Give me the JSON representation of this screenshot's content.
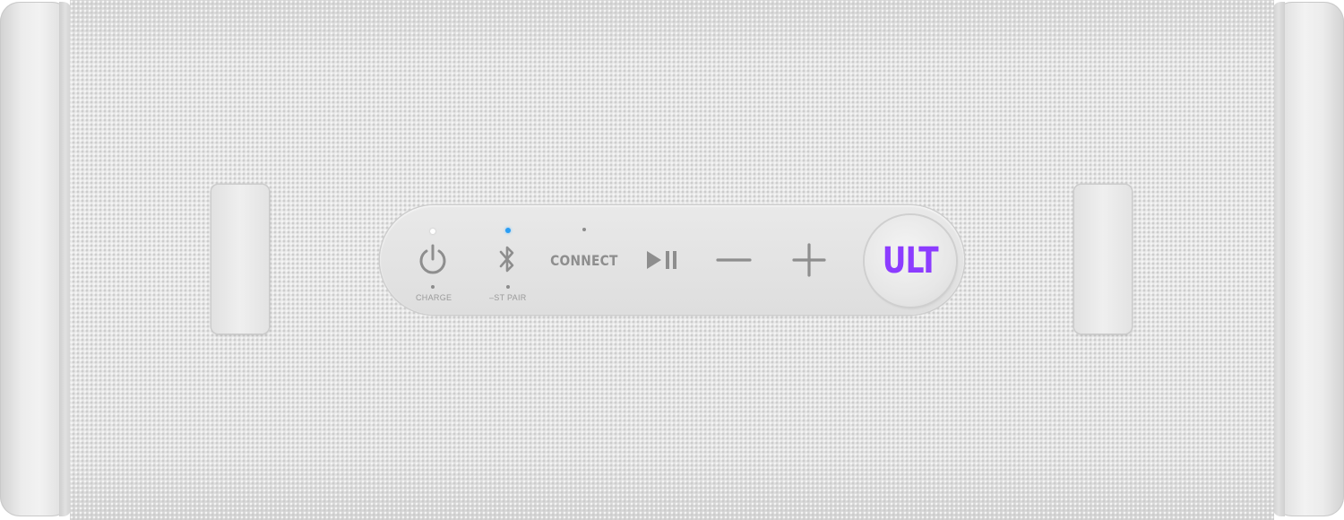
{
  "product": {
    "controls": {
      "connect_label": "CONNECT",
      "charge_label": "CHARGE",
      "pair_label": "–ST PAIR",
      "ult_label": "ULT"
    },
    "icons": {
      "power": "power-icon",
      "bluetooth": "bluetooth-icon",
      "play_pause": "play-pause-icon",
      "volume_down": "minus-icon",
      "volume_up": "plus-icon"
    },
    "colors": {
      "body": "#e6e6e6",
      "panel": "#e3e3e3",
      "icon_gray": "#8e8e8e",
      "ult_purple": "#8c3cff",
      "bluetooth_led": "#2a9df4",
      "power_led": "#ffffff"
    }
  }
}
